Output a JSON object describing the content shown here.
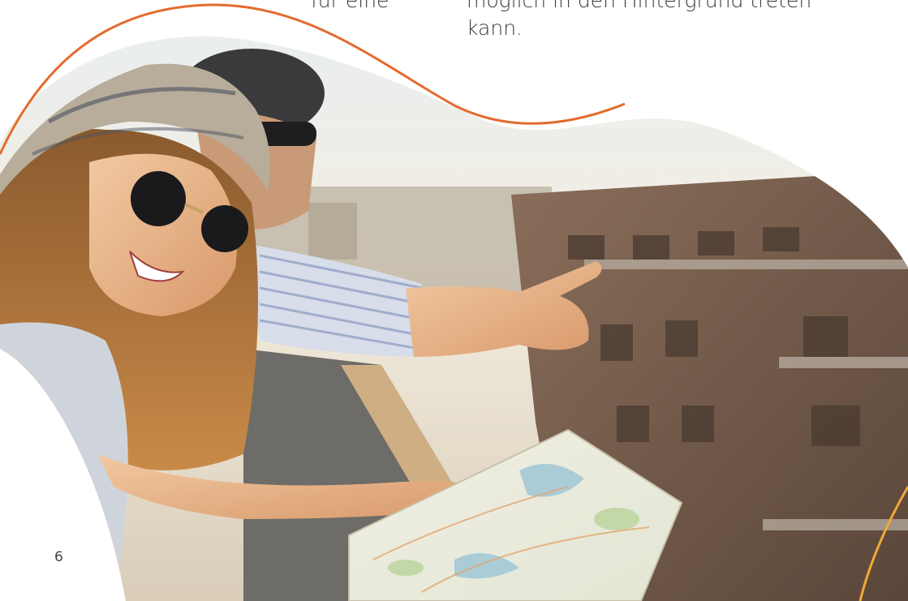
{
  "text": {
    "left_column_fragment": "für eine",
    "right_column_line1": "möglich in den Hintergrund treten",
    "right_column_line2": "kann."
  },
  "page_number": "6",
  "colors": {
    "accent_orange": "#e46b2d",
    "accent_gold": "#f0a838",
    "text": "#3a3a3a"
  },
  "photo": {
    "subject": "travel-couple-on-rooftop-with-map"
  }
}
